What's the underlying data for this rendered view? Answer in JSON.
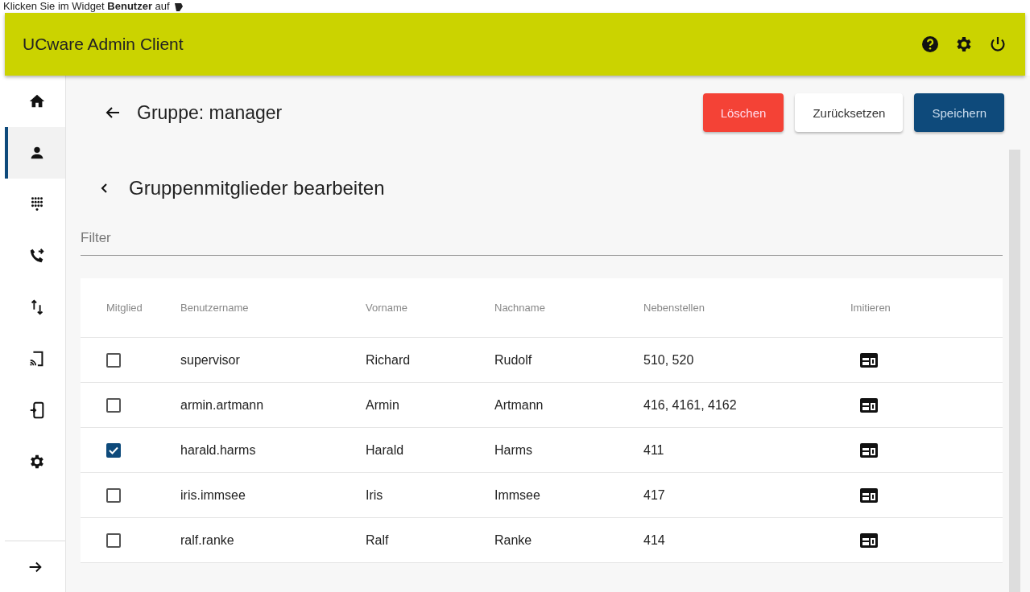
{
  "caption": "Klicken Sie im Widget **Benutzer** auf",
  "app_bar": {
    "title": "UCware Admin Client"
  },
  "sidebar": {
    "items": [
      {
        "kind": "home",
        "selected": false
      },
      {
        "kind": "person",
        "selected": true
      },
      {
        "kind": "dialpad",
        "selected": false
      },
      {
        "kind": "forward",
        "selected": false
      },
      {
        "kind": "swap",
        "selected": false
      },
      {
        "kind": "cast",
        "selected": false
      },
      {
        "kind": "device",
        "selected": false
      },
      {
        "kind": "settings",
        "selected": false
      }
    ]
  },
  "page": {
    "title": "Gruppe: manager",
    "buttons": [
      {
        "label": "Löschen",
        "kind": "danger"
      },
      {
        "label": "Zurücksetzen",
        "kind": "plain"
      },
      {
        "label": "Speichern",
        "kind": "primary"
      }
    ]
  },
  "section": {
    "title": "Gruppenmitglieder bearbeiten",
    "filter": {
      "placeholder": "Filter"
    }
  },
  "table": {
    "columns": [
      "Mitglied",
      "Benutzername",
      "Vorname",
      "Nachname",
      "Nebenstellen",
      "Imitieren"
    ],
    "rows": [
      {
        "checked": false,
        "username": "supervisor",
        "first": "Richard",
        "last": "Rudolf",
        "extensions": "510, 520"
      },
      {
        "checked": false,
        "username": "armin.artmann",
        "first": "Armin",
        "last": "Artmann",
        "extensions": "416, 4161, 4162"
      },
      {
        "checked": true,
        "username": "harald.harms",
        "first": "Harald",
        "last": "Harms",
        "extensions": "411"
      },
      {
        "checked": false,
        "username": "iris.immsee",
        "first": "Iris",
        "last": "Immsee",
        "extensions": "417"
      },
      {
        "checked": false,
        "username": "ralf.ranke",
        "first": "Ralf",
        "last": "Ranke",
        "extensions": "414"
      }
    ]
  }
}
